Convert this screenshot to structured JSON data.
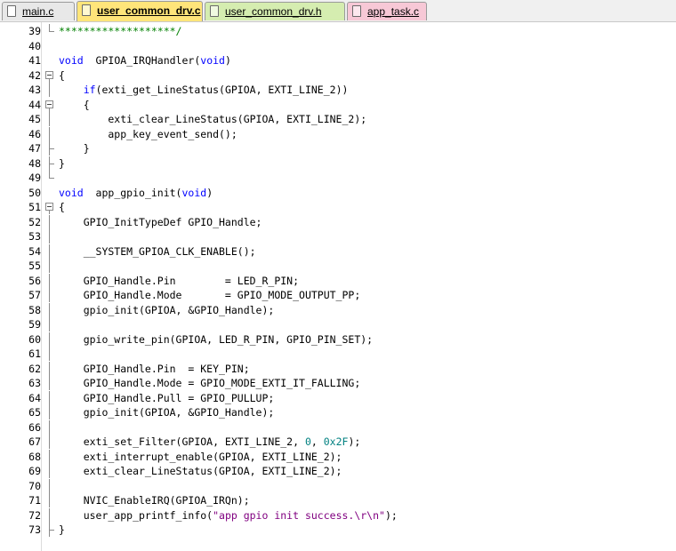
{
  "tabs": [
    {
      "label": "main.c",
      "icon": "c-file-icon",
      "color": "#e8e8e8",
      "icon_color": "#ffffff"
    },
    {
      "label": "user_common_drv.c",
      "icon": "c-file-icon",
      "color": "#ffe57a",
      "icon_color": "#fff8d0"
    },
    {
      "label": "user_common_drv.h",
      "icon": "h-file-icon",
      "color": "#d5edb0",
      "icon_color": "#f0fae0"
    },
    {
      "label": "app_task.c",
      "icon": "c-file-icon",
      "color": "#f7c8d6",
      "icon_color": "#fde8ee"
    }
  ],
  "active_tab": 1,
  "colors": {
    "keyword": "#0000ff",
    "comment": "#008000",
    "string": "#800080",
    "number": "#008080"
  },
  "lines": [
    {
      "n": "39",
      "fold": "end",
      "seg": [
        [
          "cm",
          "*******************/"
        ]
      ]
    },
    {
      "n": "40",
      "fold": "",
      "seg": []
    },
    {
      "n": "41",
      "fold": "",
      "seg": [
        [
          "kw",
          "void"
        ],
        [
          "",
          "  GPIOA_IRQHandler("
        ],
        [
          "kw",
          "void"
        ],
        [
          "",
          ")"
        ]
      ]
    },
    {
      "n": "42",
      "fold": "box",
      "seg": [
        [
          "",
          "{"
        ]
      ]
    },
    {
      "n": "43",
      "fold": "line",
      "seg": [
        [
          "",
          "    "
        ],
        [
          "kw",
          "if"
        ],
        [
          "",
          "(exti_get_LineStatus(GPIOA, EXTI_LINE_2))"
        ]
      ]
    },
    {
      "n": "44",
      "fold": "box",
      "seg": [
        [
          "",
          "    {"
        ]
      ]
    },
    {
      "n": "45",
      "fold": "line",
      "seg": [
        [
          "",
          "        exti_clear_LineStatus(GPIOA, EXTI_LINE_2);"
        ]
      ]
    },
    {
      "n": "46",
      "fold": "line",
      "seg": [
        [
          "",
          "        app_key_event_send();"
        ]
      ]
    },
    {
      "n": "47",
      "fold": "tee",
      "seg": [
        [
          "",
          "    }"
        ]
      ]
    },
    {
      "n": "48",
      "fold": "tee",
      "seg": [
        [
          "",
          "}"
        ]
      ]
    },
    {
      "n": "49",
      "fold": "end",
      "seg": []
    },
    {
      "n": "50",
      "fold": "",
      "seg": [
        [
          "kw",
          "void"
        ],
        [
          "",
          "  app_gpio_init("
        ],
        [
          "kw",
          "void"
        ],
        [
          "",
          ")"
        ]
      ]
    },
    {
      "n": "51",
      "fold": "box",
      "seg": [
        [
          "",
          "{"
        ]
      ]
    },
    {
      "n": "52",
      "fold": "line",
      "seg": [
        [
          "",
          "    GPIO_InitTypeDef GPIO_Handle;"
        ]
      ]
    },
    {
      "n": "53",
      "fold": "line",
      "seg": []
    },
    {
      "n": "54",
      "fold": "line",
      "seg": [
        [
          "",
          "    __SYSTEM_GPIOA_CLK_ENABLE();"
        ]
      ]
    },
    {
      "n": "55",
      "fold": "line",
      "seg": []
    },
    {
      "n": "56",
      "fold": "line",
      "seg": [
        [
          "",
          "    GPIO_Handle.Pin        = LED_R_PIN;"
        ]
      ]
    },
    {
      "n": "57",
      "fold": "line",
      "seg": [
        [
          "",
          "    GPIO_Handle.Mode       = GPIO_MODE_OUTPUT_PP;"
        ]
      ]
    },
    {
      "n": "58",
      "fold": "line",
      "seg": [
        [
          "",
          "    gpio_init(GPIOA, &GPIO_Handle);"
        ]
      ]
    },
    {
      "n": "59",
      "fold": "line",
      "seg": []
    },
    {
      "n": "60",
      "fold": "line",
      "seg": [
        [
          "",
          "    gpio_write_pin(GPIOA, LED_R_PIN, GPIO_PIN_SET);"
        ]
      ]
    },
    {
      "n": "61",
      "fold": "line",
      "seg": []
    },
    {
      "n": "62",
      "fold": "line",
      "seg": [
        [
          "",
          "    GPIO_Handle.Pin  = KEY_PIN;"
        ]
      ]
    },
    {
      "n": "63",
      "fold": "line",
      "seg": [
        [
          "",
          "    GPIO_Handle.Mode = GPIO_MODE_EXTI_IT_FALLING;"
        ]
      ]
    },
    {
      "n": "64",
      "fold": "line",
      "seg": [
        [
          "",
          "    GPIO_Handle.Pull = GPIO_PULLUP;"
        ]
      ]
    },
    {
      "n": "65",
      "fold": "line",
      "seg": [
        [
          "",
          "    gpio_init(GPIOA, &GPIO_Handle);"
        ]
      ]
    },
    {
      "n": "66",
      "fold": "line",
      "seg": []
    },
    {
      "n": "67",
      "fold": "line",
      "seg": [
        [
          "",
          "    exti_set_Filter(GPIOA, EXTI_LINE_2, "
        ],
        [
          "num",
          "0"
        ],
        [
          "",
          ", "
        ],
        [
          "num",
          "0x2F"
        ],
        [
          "",
          ");"
        ]
      ]
    },
    {
      "n": "68",
      "fold": "line",
      "seg": [
        [
          "",
          "    exti_interrupt_enable(GPIOA, EXTI_LINE_2);"
        ]
      ]
    },
    {
      "n": "69",
      "fold": "line",
      "seg": [
        [
          "",
          "    exti_clear_LineStatus(GPIOA, EXTI_LINE_2);"
        ]
      ]
    },
    {
      "n": "70",
      "fold": "line",
      "seg": []
    },
    {
      "n": "71",
      "fold": "line",
      "seg": [
        [
          "",
          "    NVIC_EnableIRQ(GPIOA_IRQn);"
        ]
      ]
    },
    {
      "n": "72",
      "fold": "line",
      "seg": [
        [
          "",
          "    user_app_printf_info("
        ],
        [
          "str",
          "\"app gpio init success.\\r\\n\""
        ],
        [
          "",
          ");"
        ]
      ]
    },
    {
      "n": "73",
      "fold": "tee",
      "seg": [
        [
          "",
          "}"
        ]
      ]
    }
  ]
}
